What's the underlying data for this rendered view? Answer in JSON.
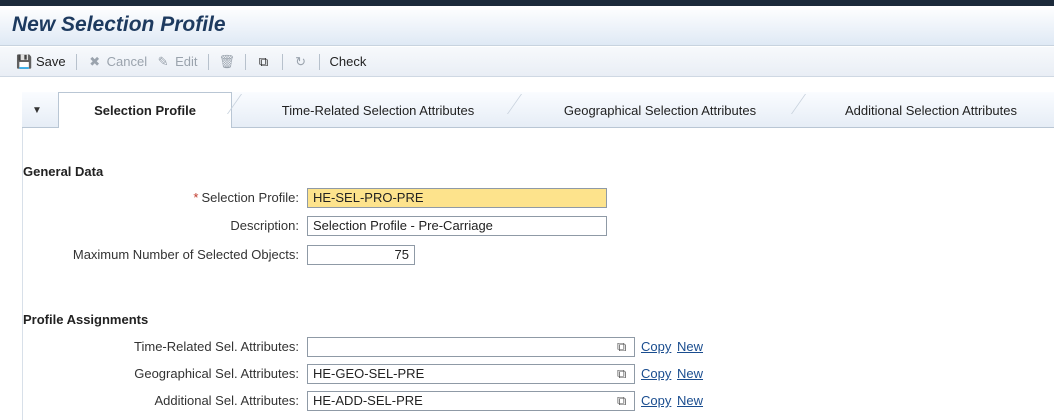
{
  "page": {
    "title": "New Selection Profile"
  },
  "toolbar": {
    "save_label": "Save",
    "cancel_label": "Cancel",
    "edit_label": "Edit",
    "check_label": "Check"
  },
  "tabs": [
    {
      "label": "Selection Profile",
      "active": true
    },
    {
      "label": "Time-Related Selection Attributes",
      "active": false
    },
    {
      "label": "Geographical Selection Attributes",
      "active": false
    },
    {
      "label": "Additional Selection Attributes",
      "active": false
    }
  ],
  "general_data": {
    "title": "General Data",
    "selection_profile_label": "Selection Profile:",
    "selection_profile_value": "HE-SEL-PRO-PRE",
    "description_label": "Description:",
    "description_value": "Selection Profile - Pre-Carriage",
    "max_objects_label": "Maximum Number of Selected Objects:",
    "max_objects_value": "75"
  },
  "profile_assignments": {
    "title": "Profile Assignments",
    "copy_label": "Copy",
    "new_label": "New",
    "rows": [
      {
        "label": "Time-Related Sel. Attributes:",
        "value": ""
      },
      {
        "label": "Geographical Sel. Attributes:",
        "value": "HE-GEO-SEL-PRE"
      },
      {
        "label": "Additional Sel. Attributes:",
        "value": "HE-ADD-SEL-PRE"
      }
    ]
  },
  "colors": {
    "required_field": "#fde38c",
    "title": "#1d3a5f",
    "link": "#1a4d8f"
  }
}
